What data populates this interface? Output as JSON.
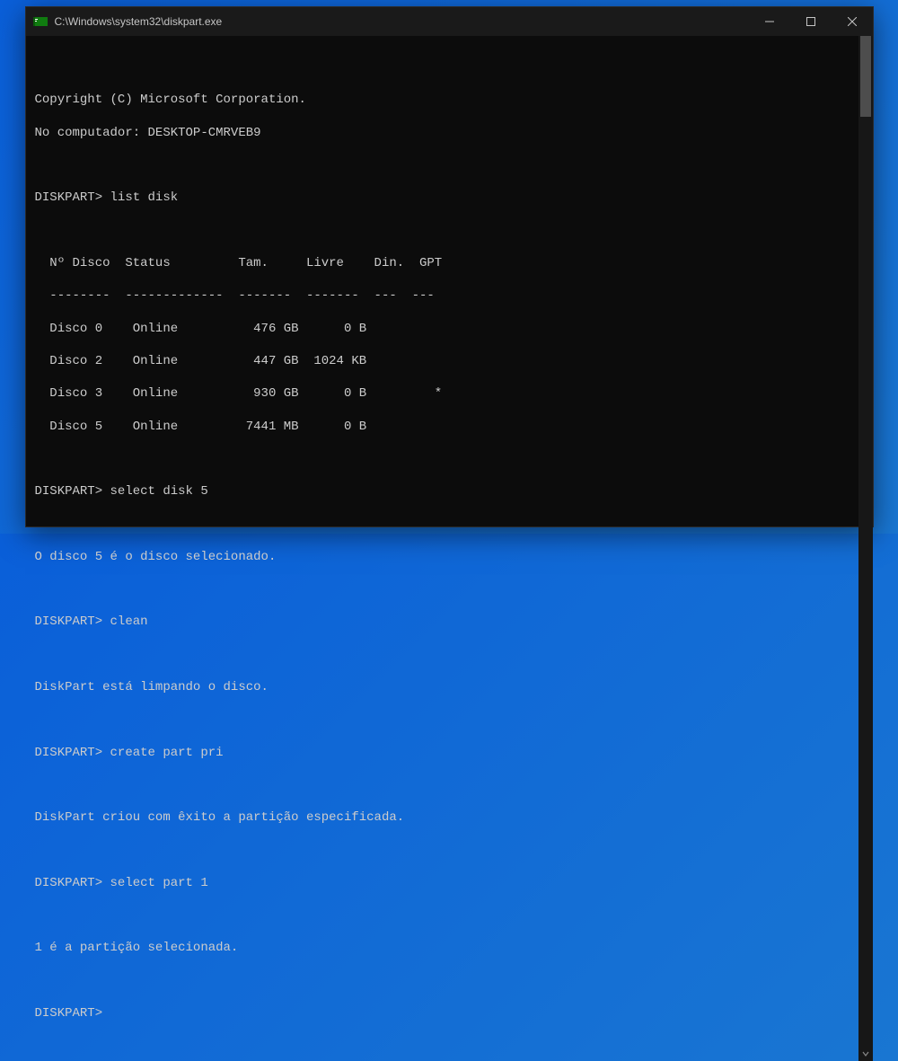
{
  "window": {
    "title": "C:\\Windows\\system32\\diskpart.exe"
  },
  "terminal": {
    "blank_top": "",
    "copyright": "Copyright (C) Microsoft Corporation.",
    "computer": "No computador: DESKTOP-CMRVEB9",
    "blank1": "",
    "prompt1_label": "DISKPART>",
    "prompt1_cmd": " list disk",
    "blank2": "",
    "table_header": "  Nº Disco  Status         Tam.     Livre    Din.  GPT",
    "table_divider": "  --------  -------------  -------  -------  ---  ---",
    "row0": "  Disco 0    Online          476 GB      0 B",
    "row1": "  Disco 2    Online          447 GB  1024 KB",
    "row2": "  Disco 3    Online          930 GB      0 B         *",
    "row3": "  Disco 5    Online         7441 MB      0 B",
    "blank3": "",
    "prompt2_label": "DISKPART>",
    "prompt2_cmd": " select disk 5",
    "blank4": "",
    "msg1": "O disco 5 é o disco selecionado.",
    "blank5": "",
    "prompt3_label": "DISKPART>",
    "prompt3_cmd": " clean",
    "blank6": "",
    "msg2": "DiskPart está limpando o disco.",
    "blank7": "",
    "prompt4_label": "DISKPART>",
    "prompt4_cmd": " create part pri",
    "blank8": "",
    "msg3": "DiskPart criou com êxito a partição especificada.",
    "blank9": "",
    "prompt5_label": "DISKPART>",
    "prompt5_cmd": " select part 1",
    "blank10": "",
    "msg4": "1 é a partição selecionada.",
    "blank11": "",
    "prompt6_label": "DISKPART>",
    "prompt6_cmd": ""
  }
}
